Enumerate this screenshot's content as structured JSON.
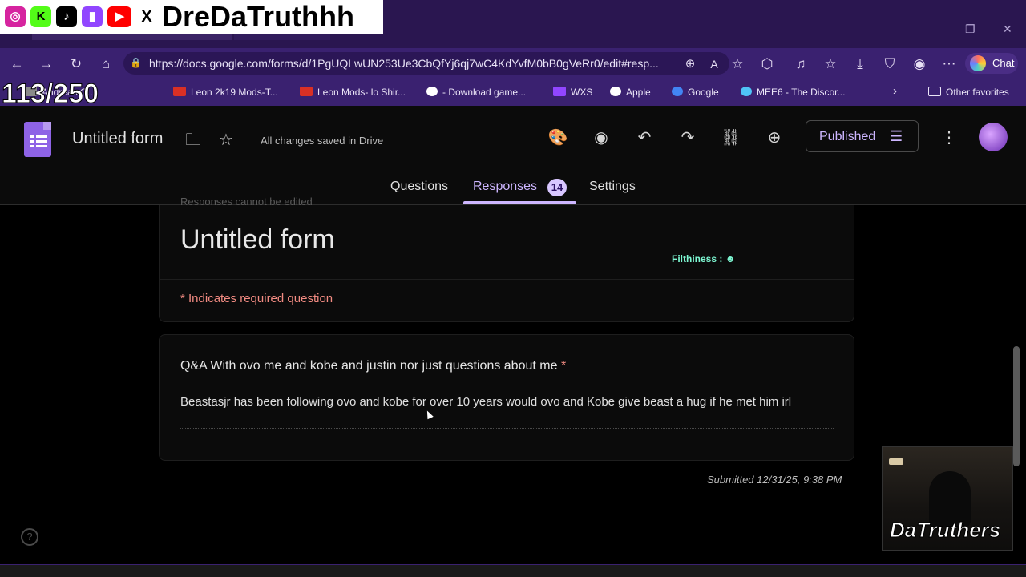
{
  "browser": {
    "url": "https://docs.google.com/forms/d/1PgUQLwUN253Ue3CbQfYj6qj7wC4KdYvfM0bB0gVeRr0/edit#resp...",
    "chat_label": "Chat",
    "bookmarks": [
      {
        "label": "Andreas C...",
        "icon": "bookmark-icon",
        "color": "#8a8a8a"
      },
      {
        "label": "Leon 2k19 Mods-T...",
        "icon": "leon-icon",
        "color": "#d93025"
      },
      {
        "label": "Leon Mods- lo Shir...",
        "icon": "leon-icon",
        "color": "#d93025"
      },
      {
        "label": "- Download game...",
        "icon": "wordpress-icon",
        "color": "#ffffff"
      },
      {
        "label": "WXS",
        "icon": "twitch-icon",
        "color": "#9146ff"
      },
      {
        "label": "Apple",
        "icon": "apple-icon",
        "color": "#ffffff"
      },
      {
        "label": "Google",
        "icon": "google-icon",
        "color": "#4285f4"
      },
      {
        "label": "MEE6 - The Discor...",
        "icon": "mee6-icon",
        "color": "#4fc3f7"
      }
    ],
    "other_favorites": "Other favorites"
  },
  "app": {
    "form_title": "Untitled form",
    "saved_status": "All changes saved in Drive",
    "published_label": "Published",
    "tabs": [
      {
        "label": "Questions"
      },
      {
        "label": "Responses",
        "badge": "14"
      },
      {
        "label": "Settings"
      }
    ]
  },
  "response": {
    "cut_text": "Responses cannot be edited",
    "title": "Untitled form",
    "required_note": "* Indicates required question",
    "question": "Q&A With ovo me and kobe and justin nor just questions about me",
    "question_star": "*",
    "answer": "Beastasjr has been following ovo and kobe for over 10 years would ovo and Kobe give beast a hug if he met him irl",
    "submitted": "Submitted 12/31/25, 9:38 PM",
    "filthiness": "Filthiness :"
  },
  "overlay": {
    "streamer_name": "DreDaTruthhh",
    "counter": "113/250",
    "cam_label": "DaTruthers"
  },
  "colors": {
    "accent": "#cdb6ff",
    "required": "#f28b82",
    "browser_chrome": "#3a2170"
  }
}
